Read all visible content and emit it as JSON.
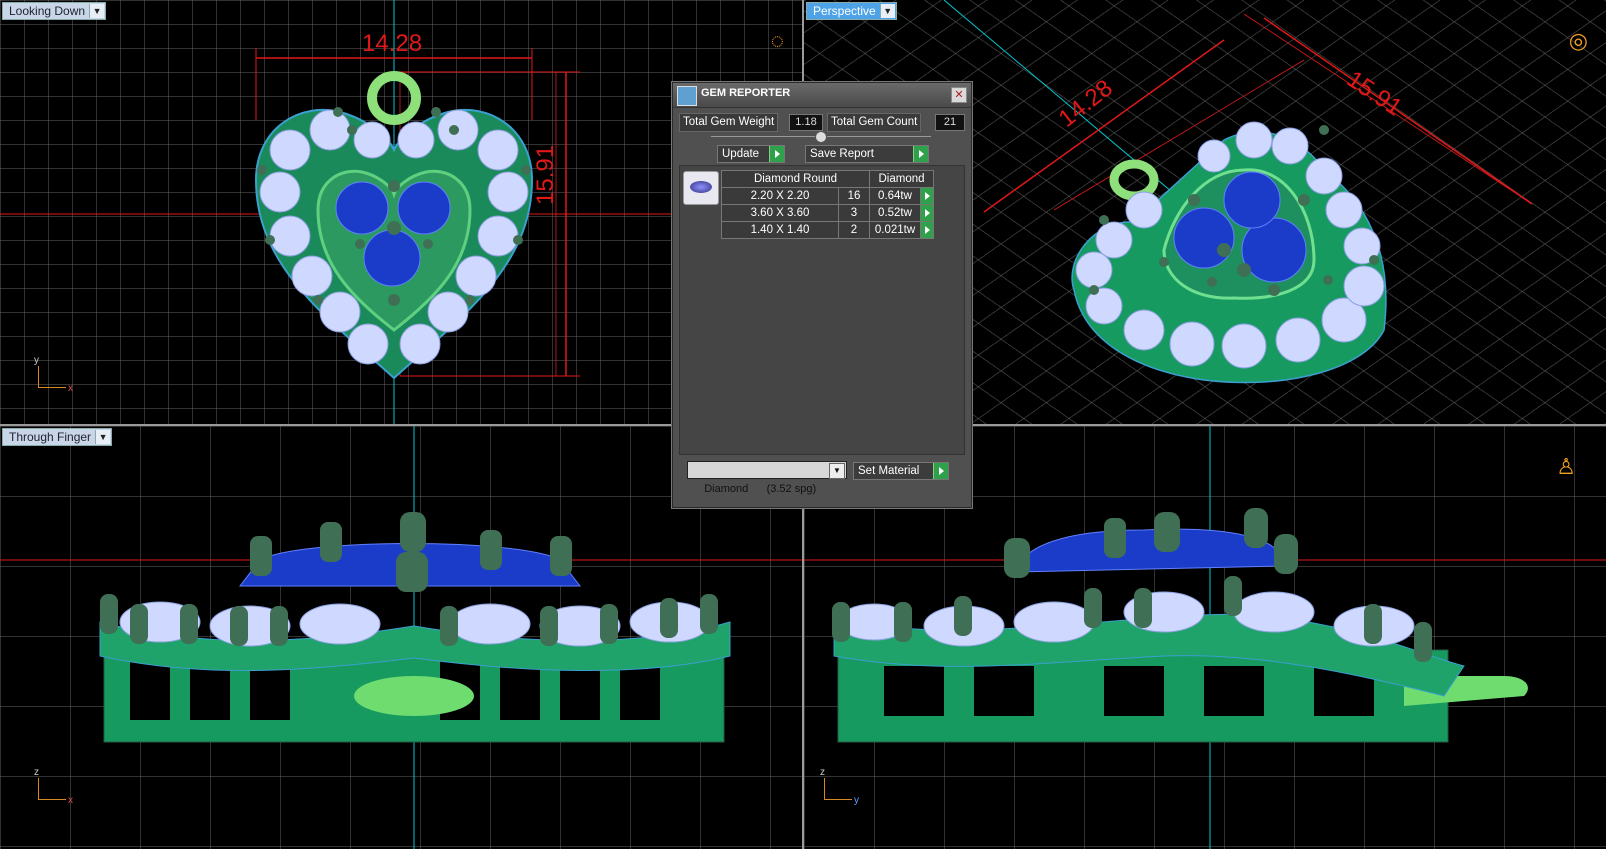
{
  "viewports": {
    "top_left": {
      "label": "Looking Down",
      "axis_v": "y",
      "axis_h": "x",
      "dim_width": "14.28",
      "dim_height": "15.91"
    },
    "top_right": {
      "label": "Perspective",
      "dim_width": "14.28",
      "dim_height": "15.91"
    },
    "bottom_left": {
      "label": "Through Finger",
      "axis_v": "z",
      "axis_h": "x"
    },
    "bottom_right": {
      "axis_v": "z",
      "axis_h": "y"
    }
  },
  "gem_reporter": {
    "title": "GEM REPORTER",
    "total_weight_label": "Total Gem Weight",
    "total_weight_value": "1.18",
    "total_count_label": "Total Gem Count",
    "total_count_value": "21",
    "update_label": "Update",
    "save_report_label": "Save Report",
    "table": {
      "headers": [
        "Diamond Round",
        "Diamond"
      ],
      "rows": [
        {
          "size": "2.20 X 2.20",
          "count": "16",
          "weight": "0.64tw"
        },
        {
          "size": "3.60 X 3.60",
          "count": "3",
          "weight": "0.52tw"
        },
        {
          "size": "1.40 X 1.40",
          "count": "2",
          "weight": "0.021tw"
        }
      ]
    },
    "material_value": "Diamond      (3.52 spg)",
    "set_material_label": "Set Material"
  },
  "colors": {
    "metal": "#1fa36a",
    "sapphire": "#1a3cc8",
    "diamond": "#cfd8ff",
    "dimension": "#e01818",
    "axis_cyan": "#00c8d0"
  }
}
